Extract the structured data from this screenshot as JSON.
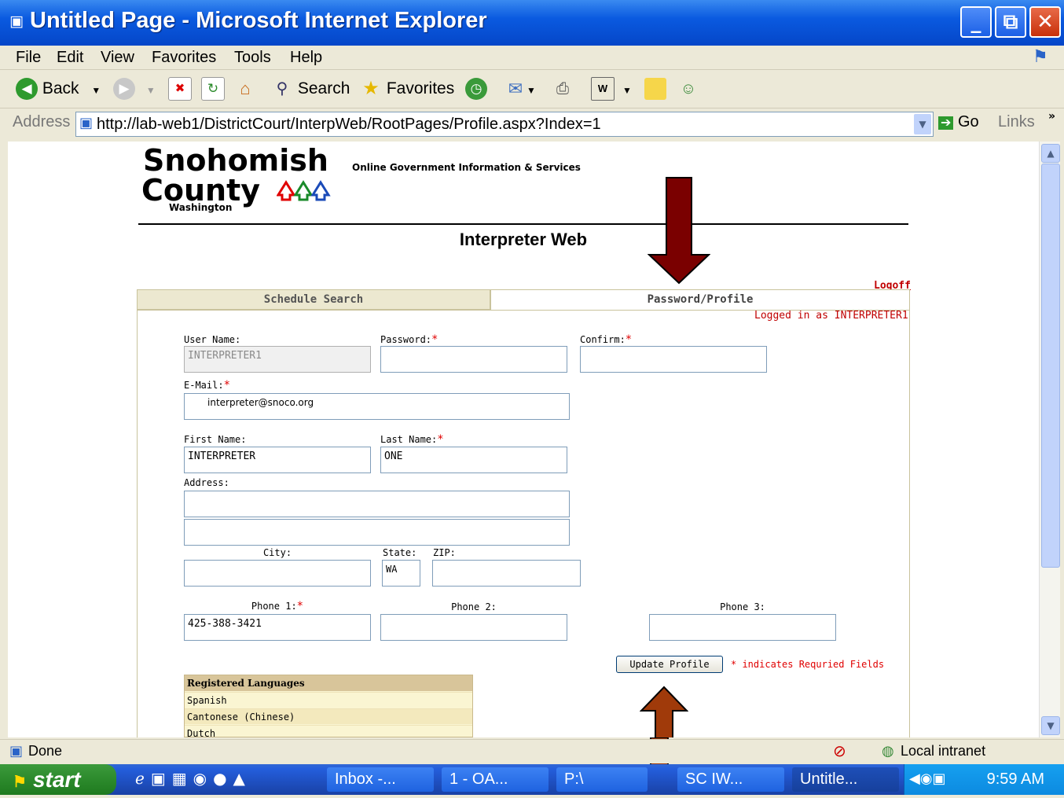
{
  "window": {
    "title": "Untitled Page - Microsoft Internet Explorer"
  },
  "menu": [
    "File",
    "Edit",
    "View",
    "Favorites",
    "Tools",
    "Help"
  ],
  "toolbar": {
    "back": "Back",
    "search": "Search",
    "favorites": "Favorites"
  },
  "address": {
    "label": "Address",
    "url": "http://lab-web1/DistrictCourt/InterpWeb/RootPages/Profile.aspx?Index=1",
    "go": "Go",
    "links": "Links"
  },
  "page": {
    "logo": {
      "line1": "Snohomish",
      "line2": "County",
      "state": "Washington",
      "tagline": "Online Government Information & Services"
    },
    "app_title": "Interpreter Web",
    "logoff": "Logoff",
    "tabs": [
      {
        "label": "Schedule Search"
      },
      {
        "label": "Password/Profile"
      }
    ],
    "logged_in": "Logged in as INTERPRETER1",
    "fields": {
      "username": {
        "label": "User Name:",
        "value": "INTERPRETER1"
      },
      "password": {
        "label": "Password:",
        "value": ""
      },
      "confirm": {
        "label": "Confirm:",
        "value": ""
      },
      "email": {
        "label": "E-Mail:",
        "value": "interpreter@snoco.org"
      },
      "first_name": {
        "label": "First Name:",
        "value": "INTERPRETER"
      },
      "last_name": {
        "label": "Last Name:",
        "value": "ONE"
      },
      "address": {
        "label": "Address:",
        "line1": "",
        "line2": ""
      },
      "city": {
        "label": "City:",
        "value": ""
      },
      "state": {
        "label": "State:",
        "value": "WA"
      },
      "zip": {
        "label": "ZIP:",
        "value": ""
      },
      "phone1": {
        "label": "Phone 1:",
        "value": "425-388-3421"
      },
      "phone2": {
        "label": "Phone 2:",
        "value": ""
      },
      "phone3": {
        "label": "Phone 3:",
        "value": ""
      }
    },
    "required_mark": "*",
    "update_button": "Update Profile",
    "required_note": "* indicates Requried Fields",
    "languages": {
      "header": "Registered Languages",
      "items": [
        "Spanish",
        "Cantonese (Chinese)",
        "Dutch"
      ]
    }
  },
  "status": {
    "text": "Done",
    "zone": "Local intranet"
  },
  "taskbar": {
    "start": "start",
    "tasks": [
      "Inbox -...",
      "1 - OA...",
      "P:\\",
      "SC IW...",
      "Untitle..."
    ],
    "clock": "9:59 AM"
  },
  "colors": {
    "arrow": "#7a0000",
    "required": "#e00000",
    "titlebar": "#0a5ae0"
  }
}
